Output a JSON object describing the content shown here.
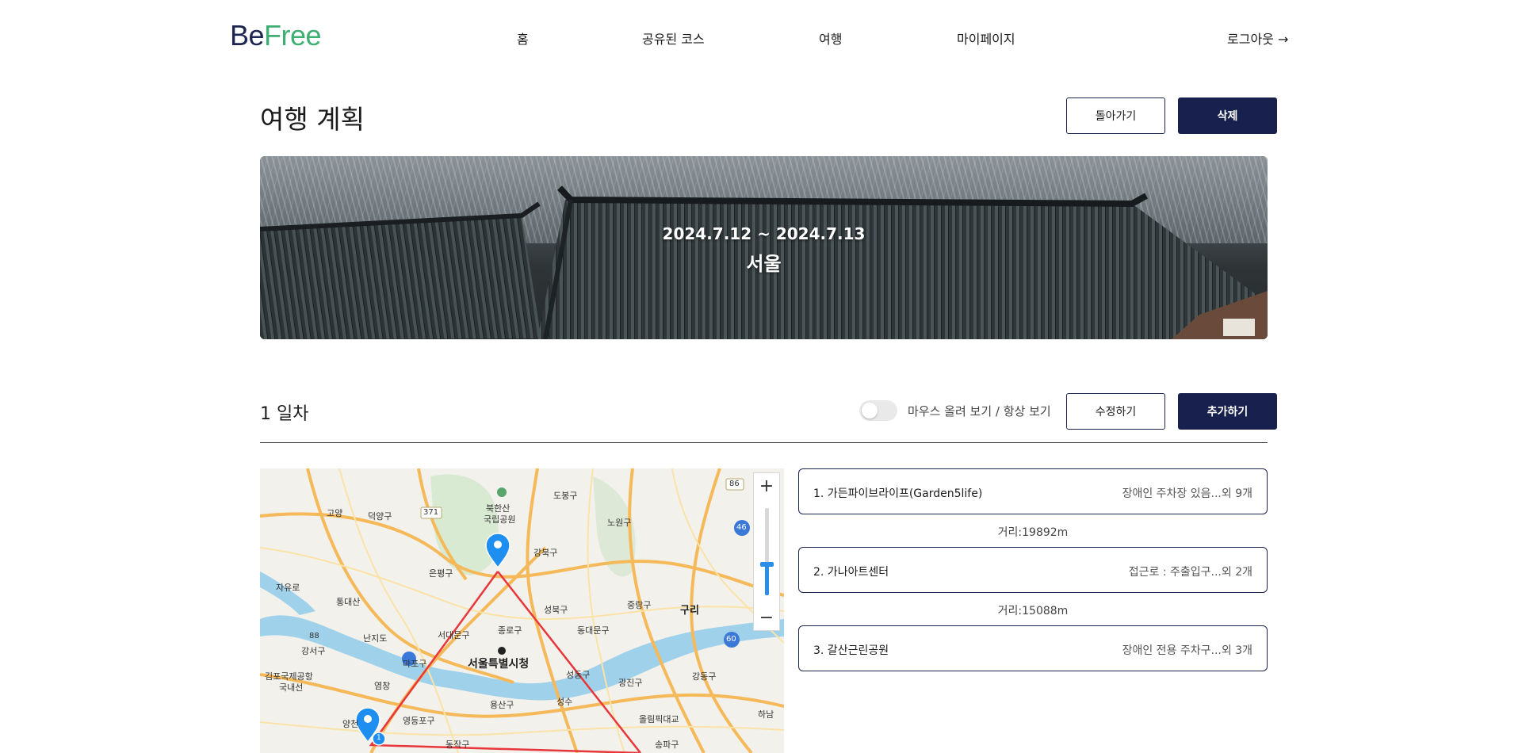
{
  "header": {
    "logo_be": "Be",
    "logo_free": "Free",
    "nav": [
      "홈",
      "공유된 코스",
      "여행",
      "마이페이지"
    ],
    "logout": "로그아웃 →"
  },
  "page": {
    "title": "여행 계획",
    "back_button": "돌아가기",
    "delete_button": "삭제"
  },
  "hero": {
    "dates": "2024.7.12 ~ 2024.7.13",
    "city": "서울"
  },
  "day": {
    "title": "1 일차",
    "toggle_label": "마우스 올려 보기 / 항상 보기",
    "toggle_on": false,
    "edit_button": "수정하기",
    "add_button": "추가하기"
  },
  "map": {
    "labels": [
      "북한산",
      "국립공원",
      "도봉구",
      "노원구",
      "고양",
      "덕양구",
      "강북구",
      "은평구",
      "자유로",
      "통대산",
      "성북구",
      "중랑구",
      "구리",
      "종로구",
      "서대문구",
      "난지도",
      "동대문구",
      "서울특별시청",
      "강서구",
      "마포구",
      "김포국제공항",
      "국내선",
      "염창",
      "성동구",
      "광진구",
      "강동구",
      "양천",
      "영등포구",
      "용산구",
      "성수",
      "올림픽대교",
      "하남",
      "동작구",
      "송파구",
      "88",
      "86",
      "46",
      "60",
      "371",
      "1"
    ],
    "zoom_in": "+",
    "zoom_out": "−",
    "zoom_level": 0.35
  },
  "places": [
    {
      "name": "1. 가든파이브라이프(Garden5life)",
      "note": "장애인 주차장 있음...외 9개"
    },
    {
      "name": "2. 가나아트센터",
      "note": "접근로 : 주출입구...외 2개"
    },
    {
      "name": "3. 갈산근린공원",
      "note": "장애인 전용 주차구...외 3개"
    }
  ],
  "distances": [
    "거리:19892m",
    "거리:15088m"
  ],
  "colors": {
    "navy": "#18214d",
    "green": "#3fae72",
    "route": "#e8363a",
    "marker": "#1f8ef1"
  }
}
